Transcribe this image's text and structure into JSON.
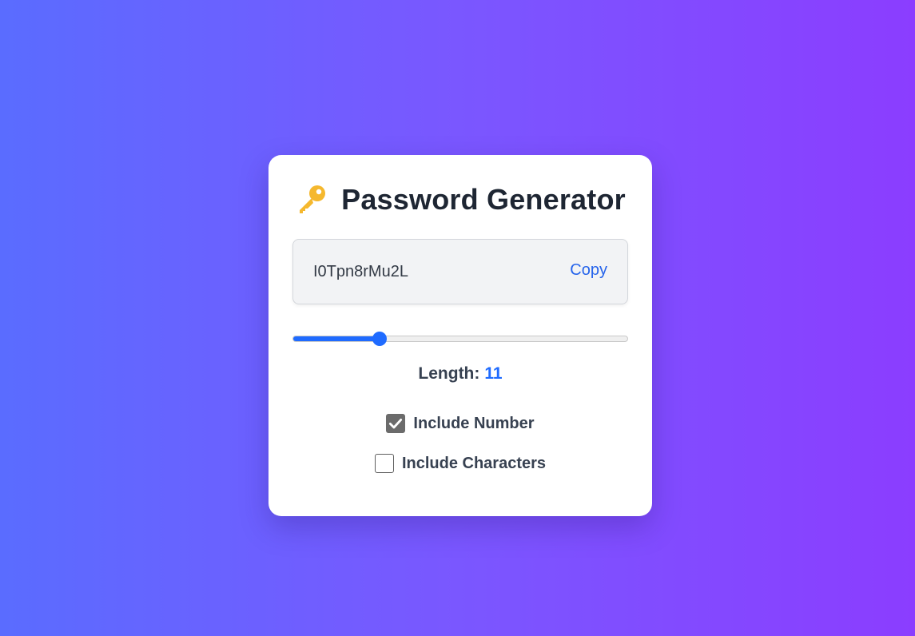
{
  "app": {
    "title": "Password Generator",
    "title_icon": "key-icon"
  },
  "password": {
    "value": "I0Tpn8rMu2L",
    "copy_label": "Copy"
  },
  "length": {
    "label": "Length:",
    "value": "11",
    "slider_fraction": 0.26
  },
  "options": [
    {
      "label": "Include Number",
      "checked": true
    },
    {
      "label": "Include Characters",
      "checked": false
    }
  ],
  "colors": {
    "accent": "#1f6bff",
    "title_text": "#1e2633",
    "key_icon": "#f5b82e",
    "checkbox_checked": "#6b6b6b"
  }
}
